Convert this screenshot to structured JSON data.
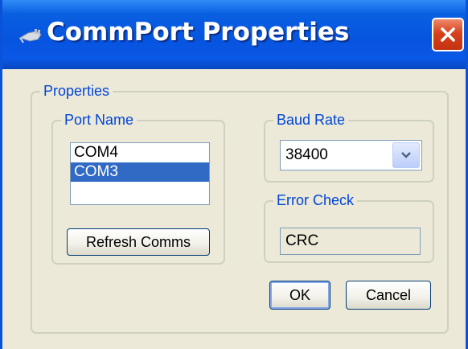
{
  "window": {
    "title": "CommPort Properties",
    "title_bar_color": "#0654df"
  },
  "properties_group": {
    "label": "Properties"
  },
  "port_name": {
    "label": "Port Name",
    "items": [
      "COM4",
      "COM3"
    ],
    "selected": "COM3",
    "refresh_label": "Refresh Comms"
  },
  "baud_rate": {
    "label": "Baud Rate",
    "value": "38400"
  },
  "error_check": {
    "label": "Error Check",
    "value": "CRC"
  },
  "buttons": {
    "ok_label": "OK",
    "cancel_label": "Cancel"
  },
  "icons": {
    "title_icon": "plug-icon",
    "close": "close-icon",
    "dropdown": "chevron-down-icon"
  },
  "colors": {
    "selection": "#316ac5",
    "group_label": "#0046d5",
    "close_button": "#d6411c"
  }
}
